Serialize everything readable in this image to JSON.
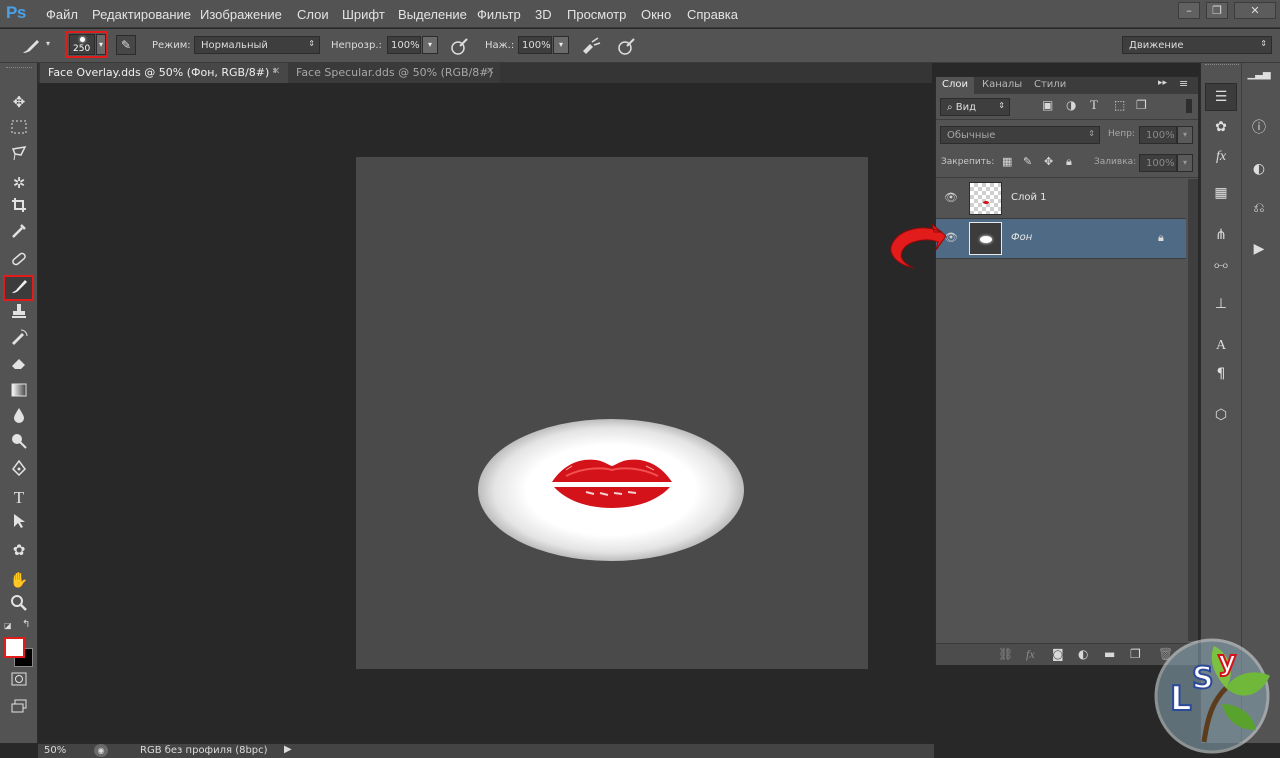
{
  "app": {
    "logo": "Ps"
  },
  "menu": [
    "Файл",
    "Редактирование",
    "Изображение",
    "Слои",
    "Шрифт",
    "Выделение",
    "Фильтр",
    "3D",
    "Просмотр",
    "Окно",
    "Справка"
  ],
  "window_controls": {
    "minimize": "–",
    "restore": "❐",
    "close": "✕"
  },
  "options": {
    "brush_size": "250",
    "mode_label": "Режим:",
    "mode_value": "Нормальный",
    "opacity_label": "Непрозр.:",
    "opacity_value": "100%",
    "pressure_label": "Наж.:",
    "pressure_value": "100%",
    "workspace": "Движение"
  },
  "tabs": [
    {
      "label": "Face Overlay.dds @ 50% (Фон, RGB/8#) *",
      "active": true
    },
    {
      "label": "Face Specular.dds @ 50% (RGB/8#)",
      "active": false
    }
  ],
  "tools": [
    "move-tool",
    "marquee-tool",
    "lasso-tool",
    "magic-wand-tool",
    "crop-tool",
    "eyedropper-tool",
    "healing-brush-tool",
    "brush-tool",
    "clone-stamp-tool",
    "history-brush-tool",
    "eraser-tool",
    "gradient-tool",
    "blur-tool",
    "dodge-tool",
    "pen-tool",
    "type-tool",
    "path-selection-tool",
    "shape-tool",
    "hand-tool",
    "zoom-tool"
  ],
  "colors": {
    "foreground": "#ffffff",
    "background": "#000000",
    "highlight": "#e21b1b",
    "selected_layer": "#4f6a85"
  },
  "layers_panel": {
    "tabs": [
      "Слои",
      "Каналы",
      "Стили"
    ],
    "filter": "Вид",
    "blend_mode": "Обычные",
    "opacity_label": "Непр:",
    "opacity_value": "100%",
    "lock_label": "Закрепить:",
    "fill_label": "Заливка:",
    "fill_value": "100%",
    "layers": [
      {
        "name": "Слой 1",
        "visible": true,
        "selected": false,
        "locked": false
      },
      {
        "name": "Фон",
        "visible": true,
        "selected": true,
        "locked": true
      }
    ]
  },
  "statusbar": {
    "zoom": "50%",
    "profile": "RGB без профиля (8bpc)"
  }
}
